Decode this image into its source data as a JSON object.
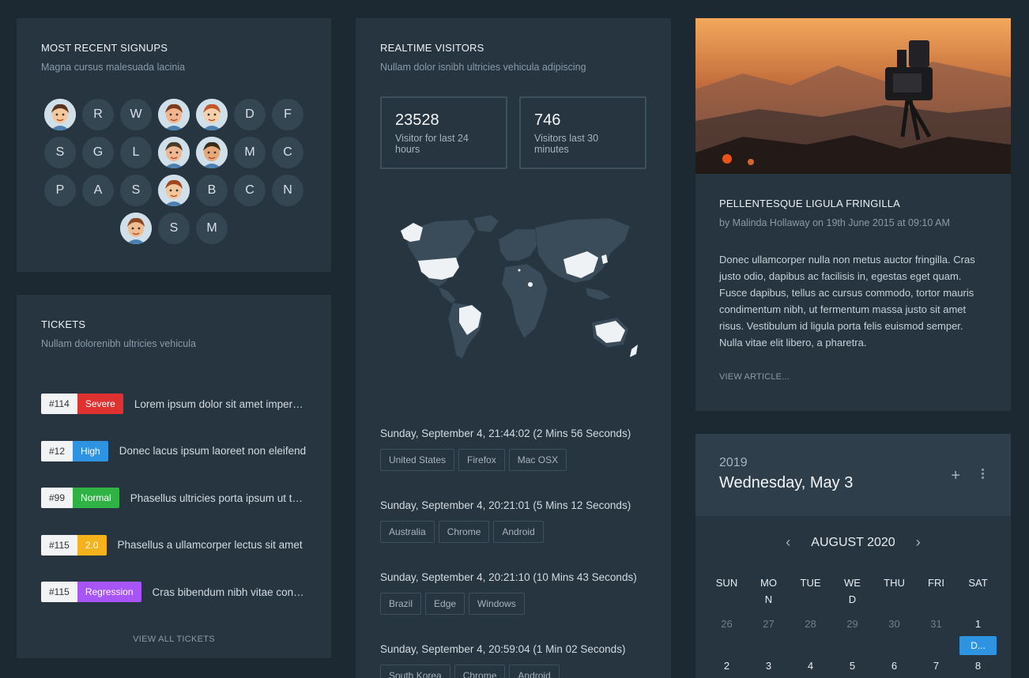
{
  "signups": {
    "title": "MOST RECENT SIGNUPS",
    "subtitle": "Magna cursus malesuada lacinia",
    "rows": [
      [
        "img",
        "R",
        "W",
        "img",
        "img",
        "D",
        "F"
      ],
      [
        "S",
        "G",
        "L",
        "img",
        "img",
        "M",
        "C"
      ],
      [
        "P",
        "A",
        "S",
        "img",
        "B",
        "C",
        "N"
      ],
      [
        "img",
        "S",
        "M"
      ]
    ]
  },
  "tickets": {
    "title": "TICKETS",
    "subtitle": "Nullam dolorenibh ultricies vehicula",
    "items": [
      {
        "id": "#114",
        "priority": "Severe",
        "color": "#e03131",
        "text": "Lorem ipsum dolor sit amet imperdiet"
      },
      {
        "id": "#12",
        "priority": "High",
        "color": "#2e93e0",
        "text": "Donec lacus ipsum laoreet non eleifend"
      },
      {
        "id": "#99",
        "priority": "Normal",
        "color": "#2fb344",
        "text": "Phasellus ultricies porta ipsum ut tempor"
      },
      {
        "id": "#115",
        "priority": "2.0",
        "color": "#f5b21d",
        "text": "Phasellus a ullamcorper lectus sit amet"
      },
      {
        "id": "#115",
        "priority": "Regression",
        "color": "#a855f7",
        "text": "Cras bibendum nibh vitae convallis"
      }
    ],
    "view_all": "VIEW ALL TICKETS"
  },
  "realtime": {
    "title": "REALTIME VISITORS",
    "subtitle": "Nullam dolor isnibh ultricies vehicula adipiscing",
    "stats": [
      {
        "value": "23528",
        "label": "Visitor for last 24 hours"
      },
      {
        "value": "746",
        "label": "Visitors last 30 minutes"
      }
    ],
    "visits": [
      {
        "time": "Sunday, September 4, 21:44:02 (2 Mins 56 Seconds)",
        "tags": [
          "United States",
          "Firefox",
          "Mac OSX"
        ]
      },
      {
        "time": "Sunday, September 4, 20:21:01 (5 Mins 12 Seconds)",
        "tags": [
          "Australia",
          "Chrome",
          "Android"
        ]
      },
      {
        "time": "Sunday, September 4, 20:21:10 (10 Mins 43 Seconds)",
        "tags": [
          "Brazil",
          "Edge",
          "Windows"
        ]
      },
      {
        "time": "Sunday, September 4, 20:59:04 (1 Min 02 Seconds)",
        "tags": [
          "South Korea",
          "Chrome",
          "Android"
        ]
      }
    ]
  },
  "article": {
    "title": "PELLENTESQUE LIGULA FRINGILLA",
    "byline": "by Malinda Hollaway on 19th June 2015 at 09:10 AM",
    "body": "Donec ullamcorper nulla non metus auctor fringilla. Cras justo odio, dapibus ac facilisis in, egestas eget quam. Fusce dapibus, tellus ac cursus commodo, tortor mauris condimentum nibh, ut fermentum massa justo sit amet risus. Vestibulum id ligula porta felis euismod semper. Nulla vitae elit libero, a pharetra.",
    "link": "VIEW ARTICLE..."
  },
  "calendar": {
    "year": "2019",
    "date": "Wednesday, May 3",
    "month": "AUGUST 2020",
    "weekdays": [
      "SUN",
      "MON",
      "TUE",
      "WED",
      "THU",
      "FRI",
      "SAT"
    ],
    "row1": [
      "26",
      "27",
      "28",
      "29",
      "30",
      "31",
      "1"
    ],
    "row2": [
      "2",
      "3",
      "4",
      "5",
      "6",
      "7",
      "8"
    ],
    "event_label": "D...",
    "accent": "#2e93e0"
  }
}
